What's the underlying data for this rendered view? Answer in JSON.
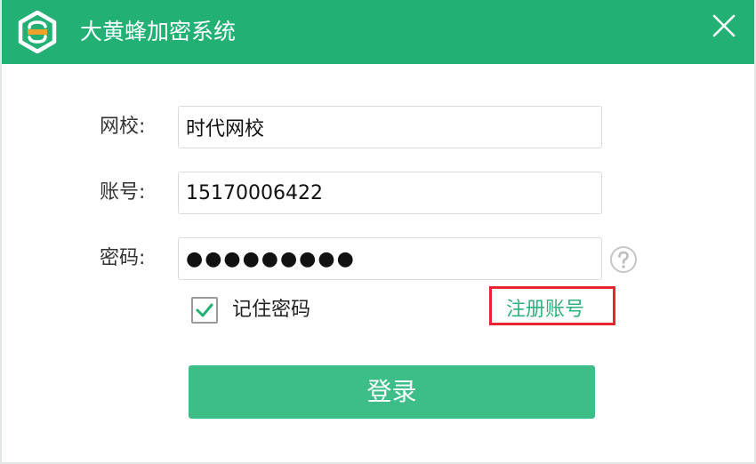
{
  "window": {
    "title": "大黄蜂加密系统"
  },
  "colors": {
    "titlebar": "#23b074",
    "button": "#3dbe88",
    "link": "#2fb37e",
    "highlight": "#e8262f"
  },
  "icons": {
    "logo": "hexagon-logo-icon",
    "close": "close-icon",
    "help": "help-question-icon",
    "check": "checkmark-icon"
  },
  "form": {
    "school_label": "网校:",
    "school_value": "时代网校",
    "account_label": "账号:",
    "account_value": "15170006422",
    "password_label": "密码:",
    "password_value": "●●●●●●●●●",
    "remember_label": "记住密码",
    "remember_checked": true,
    "register_link": "注册账号",
    "login_button": "登录"
  }
}
